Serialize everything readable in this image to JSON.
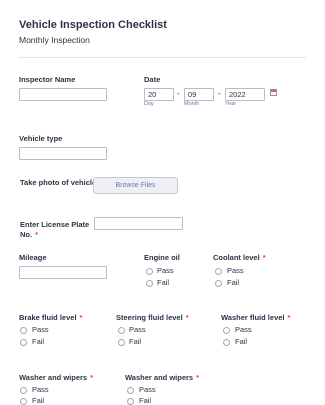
{
  "header": {
    "title": "Vehicle Inspection Checklist",
    "subtitle": "Monthly Inspection"
  },
  "inspector": {
    "label": "Inspector Name",
    "value": ""
  },
  "date": {
    "label": "Date",
    "day": "20",
    "month": "09",
    "year": "2022",
    "day_label": "Day",
    "month_label": "Month",
    "year_label": "Year",
    "separator": "-",
    "icon": "calendar-icon"
  },
  "vehicle_type": {
    "label": "Vehicle type",
    "value": ""
  },
  "photo": {
    "label": "Take photo of vehicle",
    "button_label": "Browse Files"
  },
  "plate": {
    "label_line1": "Enter License Plate",
    "label_line2": "No.",
    "required": "*",
    "value": ""
  },
  "mileage": {
    "label": "Mileage",
    "value": ""
  },
  "engine_oil": {
    "label": "Engine oil",
    "options": [
      "Pass",
      "Fail"
    ]
  },
  "coolant": {
    "label": "Coolant level",
    "required": "*",
    "options": [
      "Pass",
      "Fail"
    ]
  },
  "brake_fluid": {
    "label": "Brake fluid level",
    "required": "*",
    "options": [
      "Pass",
      "Fail"
    ]
  },
  "steering_fluid": {
    "label": "Steering fluid level",
    "required": "*",
    "options": [
      "Pass",
      "Fail"
    ]
  },
  "washer_fluid": {
    "label": "Washer fluid level",
    "required": "*",
    "options": [
      "Pass",
      "Fail"
    ]
  },
  "washer_wipers_1": {
    "label": "Washer and wipers",
    "required": "*",
    "options": [
      "Pass",
      "Fail"
    ]
  },
  "washer_wipers_2": {
    "label": "Washer and wipers",
    "required": "*",
    "options": [
      "Pass",
      "Fail"
    ]
  },
  "colors": {
    "required": "#f23a3c",
    "sublabel": "#6f76a7",
    "text": "#2c3345"
  }
}
